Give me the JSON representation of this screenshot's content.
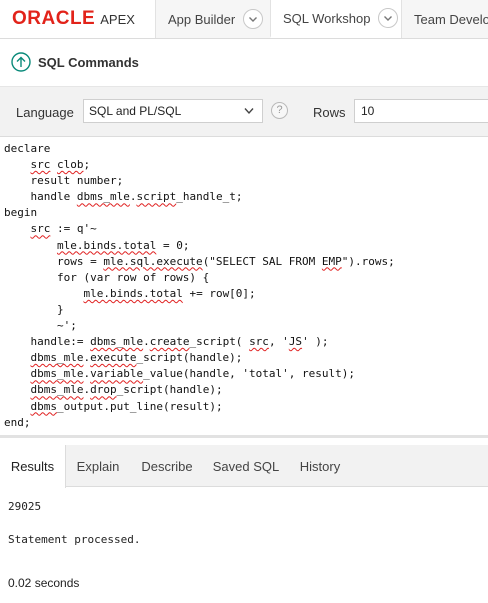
{
  "app": {
    "logo_brand": "ORACLE",
    "logo_product": "APEX"
  },
  "nav": {
    "tabs": [
      {
        "label": "App Builder",
        "active": false
      },
      {
        "label": "SQL Workshop",
        "active": true
      },
      {
        "label": "Team Develop",
        "active": false
      }
    ]
  },
  "page": {
    "title": "SQL Commands",
    "icon": "arrow-up-circle-icon"
  },
  "toolbar": {
    "language_label": "Language",
    "language_value": "SQL and PL/SQL",
    "help_glyph": "?",
    "rows_label": "Rows",
    "rows_value": "10"
  },
  "editor": {
    "lines": [
      "declare",
      "    src clob;",
      "    result number;",
      "    handle dbms_mle.script_handle_t;",
      "begin",
      "    src := q'~",
      "        mle.binds.total = 0;",
      "        rows = mle.sql.execute(\"SELECT SAL FROM EMP\").rows;",
      "        for (var row of rows) {",
      "            mle.binds.total += row[0];",
      "        }",
      "        ~';",
      "    handle:= dbms_mle.create_script( src, 'JS' );",
      "    dbms_mle.execute_script(handle);",
      "    dbms_mle.variable_value(handle, 'total', result);",
      "    dbms_mle.drop_script(handle);",
      "    dbms_output.put_line(result);",
      "end;"
    ]
  },
  "results": {
    "tabs": [
      {
        "label": "Results",
        "active": true
      },
      {
        "label": "Explain",
        "active": false
      },
      {
        "label": "Describe",
        "active": false
      },
      {
        "label": "Saved SQL",
        "active": false
      },
      {
        "label": "History",
        "active": false
      }
    ],
    "output_value": "29025",
    "status_message": "Statement processed.",
    "timing": "0.02 seconds"
  },
  "colors": {
    "brand_red": "#e2231a",
    "accent_teal": "#0a8a7a",
    "spell_underline": "#e02020"
  }
}
